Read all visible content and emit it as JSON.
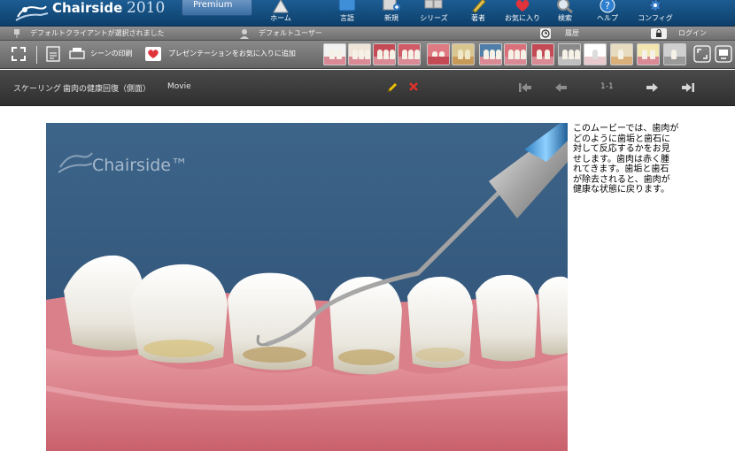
{
  "app": {
    "name": "Chairside",
    "year": "2010",
    "edition": "Premium"
  },
  "nav": [
    {
      "id": "home",
      "label": "ホーム",
      "icon": "home-icon"
    },
    {
      "id": "language",
      "label": "言語",
      "icon": "language-icon"
    },
    {
      "id": "new",
      "label": "新規",
      "icon": "new-icon"
    },
    {
      "id": "series",
      "label": "シリーズ",
      "icon": "series-icon"
    },
    {
      "id": "author",
      "label": "著者",
      "icon": "author-icon"
    },
    {
      "id": "favorites",
      "label": "お気に入り",
      "icon": "favorites-icon"
    },
    {
      "id": "search",
      "label": "検索",
      "icon": "search-icon"
    },
    {
      "id": "help",
      "label": "ヘルプ",
      "icon": "help-icon"
    },
    {
      "id": "config",
      "label": "コンフィグ",
      "icon": "gear-icon"
    }
  ],
  "status": {
    "client": "デフォルトクライアントが選択されました",
    "user": "デフォルトユーザー",
    "history": "履歴",
    "login": "ログイン"
  },
  "toolbar": {
    "print_scene": "シーンの印刷",
    "add_to_favorites": "プレゼンテーションをお気に入りに追加"
  },
  "title_bar": {
    "category": "スケーリング",
    "title": "歯肉の健康回復（側面）",
    "type": "Movie",
    "page_indicator": "1-1"
  },
  "video": {
    "watermark": "Chairside™"
  },
  "description": "このムービーでは、歯肉が\nどのように歯垢と歯石に\n対して反応するかをお見\nせします。歯肉は赤く腫\nれてきます。歯垢と歯石\nが除去されると、歯肉が\n健康な状態に戻ります。",
  "colors": {
    "header_blue": "#134f83",
    "toolbar_gray": "#7a7a7a",
    "titlebar_dark": "#3a3a3a",
    "video_bg": "#3a6187",
    "gum_pink": "#d9757f",
    "pencil_yellow": "#f2c200",
    "delete_red": "#e0322c"
  }
}
